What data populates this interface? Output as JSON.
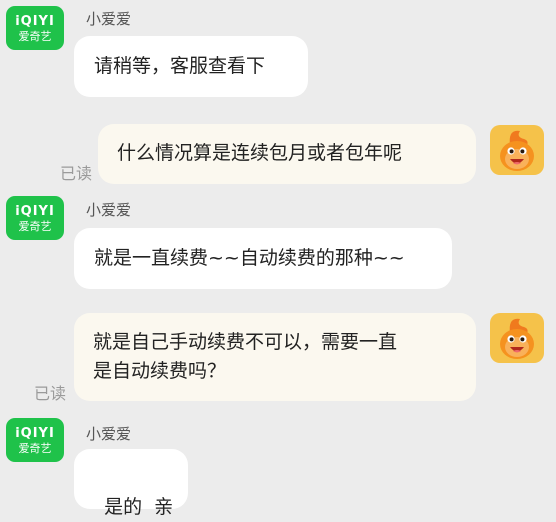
{
  "brand": {
    "logo_line1": "iQIYI",
    "logo_line2": "爱奇艺",
    "color": "#1fc24a"
  },
  "messages": [
    {
      "from": "agent",
      "sender": "小爱爱",
      "text": "请稍等，客服查看下"
    },
    {
      "from": "user",
      "text": "什么情况算是连续包月或者包年呢",
      "status": "已读"
    },
    {
      "from": "agent",
      "sender": "小爱爱",
      "text": "就是一直续费~~自动续费的那种~~"
    },
    {
      "from": "user",
      "lines": [
        "就是自己手动续费不可以，需要一直",
        "是自动续费吗？"
      ],
      "status": "已读"
    },
    {
      "from": "agent",
      "sender": "小爱爱",
      "text": "是的  亲"
    }
  ]
}
